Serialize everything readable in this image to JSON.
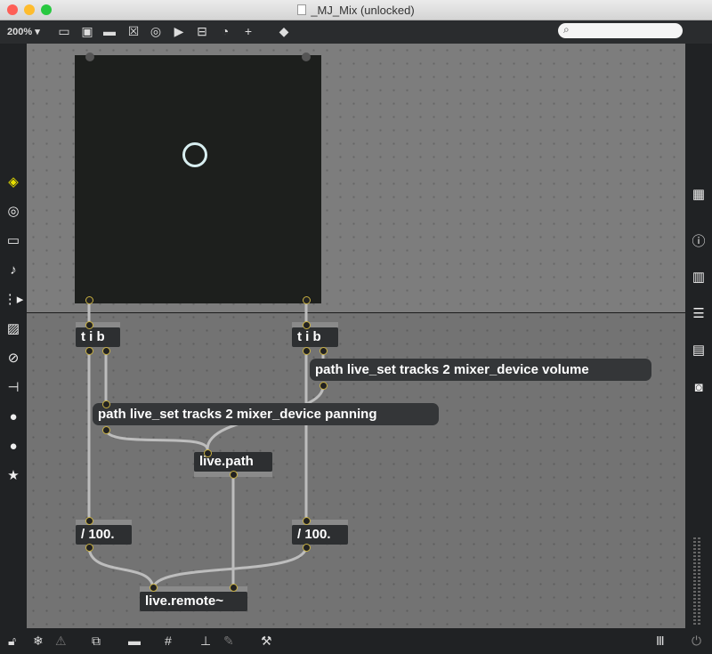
{
  "window": {
    "title": "_MJ_Mix (unlocked)",
    "traffic_lights": {
      "close": "#fe5f57",
      "minimize": "#febc2e",
      "zoom": "#28c840"
    }
  },
  "toolbar": {
    "zoom_label": "200% ▾",
    "icons": [
      "presentation-icon",
      "comment-icon",
      "message-icon",
      "toggle-icon",
      "button-icon",
      "play-icon",
      "number-icon",
      "dial-icon",
      "add-object-icon",
      "paint-bucket-icon"
    ]
  },
  "search": {
    "placeholder": ""
  },
  "left_sidebar": {
    "icons": [
      "cube-icon",
      "target-icon",
      "keyboard-icon",
      "music-note-icon",
      "sequence-icon",
      "image-icon",
      "paperclip-icon",
      "plug-icon",
      "vizzie-icon",
      "bpatcher-icon",
      "star-icon"
    ],
    "active_color": "#e8e000"
  },
  "right_sidebar": {
    "icons": [
      "grid-icon",
      "info-icon",
      "book-open-icon",
      "list-icon",
      "reference-icon",
      "snapshot-icon"
    ]
  },
  "patch": {
    "objects": {
      "trigger_left": "t i b",
      "trigger_right": "t i b",
      "msg_volume": "path live_set tracks 2 mixer_device volume",
      "msg_panning": "path live_set tracks 2 mixer_device panning",
      "live_path": "live.path",
      "div_left": "/ 100.",
      "div_right": "/ 100.",
      "live_remote": "live.remote~"
    },
    "colors": {
      "canvas": "#737373",
      "object": "#2d2f31",
      "port": "#c8b040",
      "wire": "#bdbdbd",
      "pad_handle": "#d8eef0"
    }
  },
  "bottom_bar": {
    "icons": [
      "lock-icon",
      "freeze-icon",
      "warning-icon",
      "windows-icon",
      "presentation-mode-icon",
      "grid-snap-icon",
      "hierarchy-icon",
      "debug-icon",
      "wrench-icon",
      "meter-icon",
      "power-icon"
    ]
  }
}
